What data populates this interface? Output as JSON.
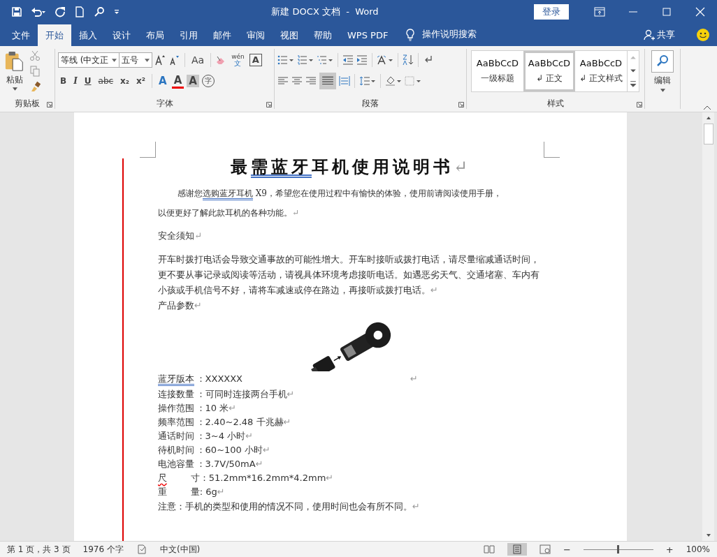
{
  "window": {
    "title": "新建 DOCX 文档  -  Word",
    "signin": "登录"
  },
  "tabs": [
    {
      "label": "文件",
      "selected": false
    },
    {
      "label": "开始",
      "selected": true
    },
    {
      "label": "插入",
      "selected": false
    },
    {
      "label": "设计",
      "selected": false
    },
    {
      "label": "布局",
      "selected": false
    },
    {
      "label": "引用",
      "selected": false
    },
    {
      "label": "邮件",
      "selected": false
    },
    {
      "label": "审阅",
      "selected": false
    },
    {
      "label": "视图",
      "selected": false
    },
    {
      "label": "帮助",
      "selected": false
    },
    {
      "label": "WPS PDF",
      "selected": false
    }
  ],
  "tell_me": "操作说明搜索",
  "share": "共享",
  "ribbon": {
    "clipboard": {
      "paste": "粘贴",
      "label": "剪贴板"
    },
    "font": {
      "name": "等线 (中文正",
      "size": "五号",
      "case": "Aa",
      "phonetic_top": "wén",
      "phonetic_bottom": "文",
      "border_char": "A",
      "format_buttons": [
        "B",
        "I",
        "U",
        "abc",
        "x₂",
        "x²"
      ],
      "effects": [
        "A",
        "A",
        "A",
        "字"
      ],
      "label": "字体"
    },
    "paragraph": {
      "label": "段落"
    },
    "styles": {
      "items": [
        {
          "sample": "AaBbCcD",
          "name": "一级标题",
          "selected": false
        },
        {
          "sample": "AaBbCcD",
          "name": "正文",
          "mark": "↲",
          "selected": true
        },
        {
          "sample": "AaBbCcD",
          "name": "正文样式",
          "mark": "↲",
          "selected": false
        }
      ],
      "label": "样式"
    },
    "editing": {
      "label": "编辑"
    }
  },
  "document": {
    "title": [
      {
        "text": "最",
        "flagged": false
      },
      {
        "text": "需蓝牙",
        "flagged": true
      },
      {
        "text": "耳机使用说明书",
        "flagged": false
      }
    ],
    "intro_first": [
      {
        "text": "感谢您",
        "flagged": false
      },
      {
        "text": "选购蓝牙耳机",
        "flagged": true
      },
      {
        "text": " X9，希望您在使用过程中有愉快的体验，使用前请阅读使用手册，",
        "flagged": false
      }
    ],
    "intro_second": "以便更好了解此款耳机的各种功能。",
    "safety_heading": "安全须知",
    "safety_text": "开车时拨打电话会导致交通事故的可能性增大。开车时接听或拨打电话，请尽量缩减通话时间，更不要从事记录或阅读等活动，请视具体环境考虑接听电话。如遇恶劣天气、交通堵塞、车内有小孩或手机信号不好，请将车减速或停在路边，再接听或拨打电话。",
    "params_heading": "产品参数",
    "params": [
      {
        "label": [
          {
            "text": "蓝牙版本",
            "grammar": true,
            "spelling": false
          }
        ],
        "value": "：XXXXXX"
      },
      {
        "label": [
          {
            "text": "连接数量",
            "grammar": false,
            "spelling": false
          }
        ],
        "value": "：可同时连接两台手机"
      },
      {
        "label": [
          {
            "text": "操作范围",
            "grammar": false,
            "spelling": false
          }
        ],
        "value": "：10 米"
      },
      {
        "label": [
          {
            "text": "频率范围",
            "grammar": false,
            "spelling": false
          }
        ],
        "value": "：2.40~2.48 千兆赫"
      },
      {
        "label": [
          {
            "text": "通话时间",
            "grammar": false,
            "spelling": false
          }
        ],
        "value": "：3~4 小时"
      },
      {
        "label": [
          {
            "text": "待机时间",
            "grammar": false,
            "spelling": false
          }
        ],
        "value": "：60~100 小时"
      },
      {
        "label": [
          {
            "text": "电池容量",
            "grammar": false,
            "spelling": false
          }
        ],
        "value": "：3.7V/50mA"
      },
      {
        "label": [
          {
            "text": "尺",
            "grammar": false,
            "spelling": true
          },
          {
            "text": "寸",
            "grammar": false,
            "spelling": false
          }
        ],
        "value": "：51.2mm*16.2mm*4.2mm"
      },
      {
        "label": [
          {
            "text": "重",
            "grammar": false,
            "spelling": false
          },
          {
            "text": "量",
            "grammar": false,
            "spelling": false
          }
        ],
        "value": ": 6g"
      }
    ],
    "note": "注意：手机的类型和使用的情况不同，使用时间也会有所不同。",
    "mark": "↵"
  },
  "status_bar": {
    "page": "第 1 页，共 3 页",
    "words": "1976 个字",
    "language": "中文(中国)",
    "zoom_out": "−",
    "zoom_in": "+",
    "zoom": "100%",
    "zoom_slider": {
      "level": 0.5
    }
  }
}
